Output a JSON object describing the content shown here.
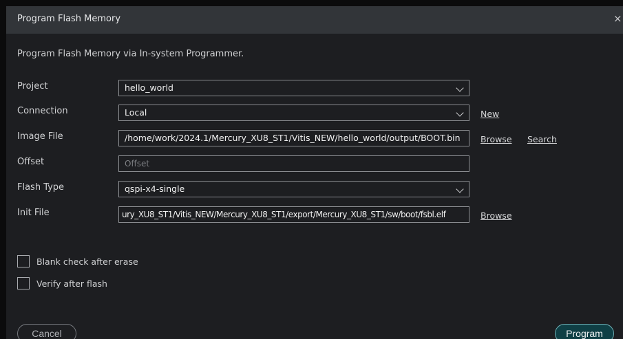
{
  "dialog": {
    "title": "Program Flash Memory",
    "close_symbol": "×",
    "subtitle": "Program Flash Memory via In-system Programmer."
  },
  "form": {
    "project": {
      "label": "Project",
      "value": "hello_world"
    },
    "connection": {
      "label": "Connection",
      "value": "Local",
      "new_link": "New"
    },
    "image_file": {
      "label": "Image File",
      "value": "/home/work/2024.1/Mercury_XU8_ST1/Vitis_NEW/hello_world/output/BOOT.bin",
      "browse_link": "Browse",
      "search_link": "Search"
    },
    "offset": {
      "label": "Offset",
      "placeholder": "Offset"
    },
    "flash_type": {
      "label": "Flash Type",
      "value": "qspi-x4-single"
    },
    "init_file": {
      "label": "Init File",
      "value": "ury_XU8_ST1/Vitis_NEW/Mercury_XU8_ST1/export/Mercury_XU8_ST1/sw/boot/fsbl.elf",
      "browse_link": "Browse"
    }
  },
  "options": {
    "blank_check": {
      "label": "Blank check after erase",
      "checked": false
    },
    "verify": {
      "label": "Verify after flash",
      "checked": false
    }
  },
  "buttons": {
    "cancel": "Cancel",
    "program": "Program"
  }
}
